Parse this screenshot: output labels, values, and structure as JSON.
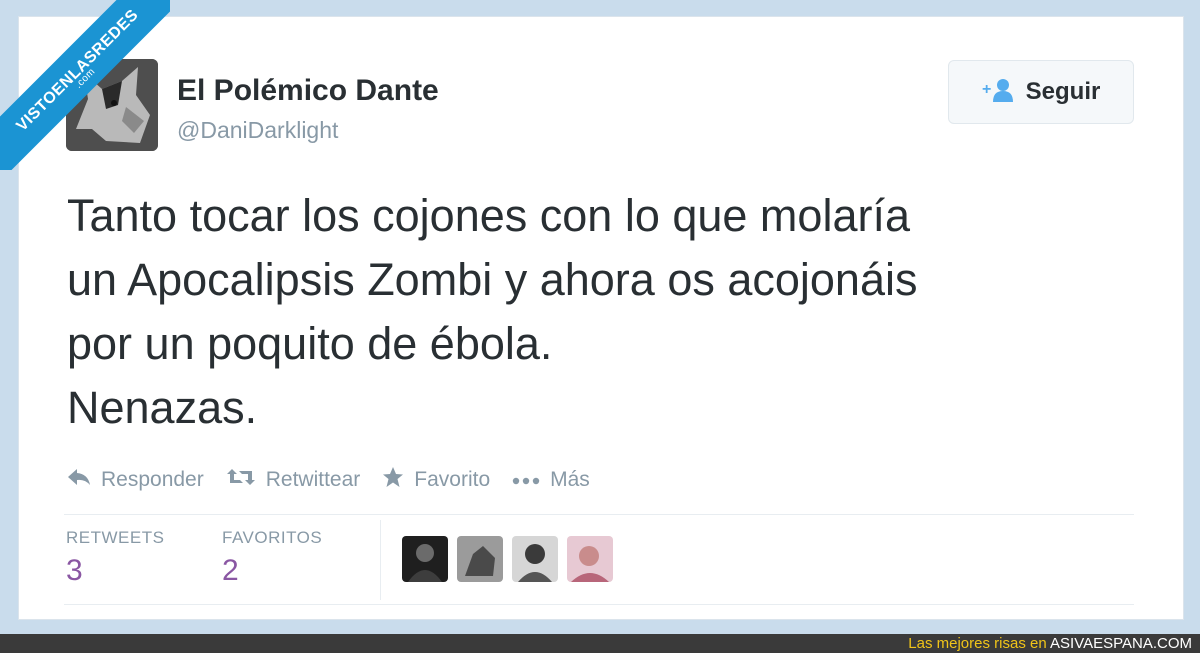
{
  "watermark": {
    "line1": "VISTOENLASREDES",
    "line2": ".com"
  },
  "tweet": {
    "display_name": "El Polémico Dante",
    "handle": "@DaniDarklight",
    "follow_label": "Seguir",
    "text": "Tanto tocar los cojones con lo que molaría\nun Apocalipsis Zombi y ahora os acojonáis\npor un poquito de ébola.\nNenazas."
  },
  "actions": {
    "reply": "Responder",
    "retweet": "Retwittear",
    "favorite": "Favorito",
    "more": "Más"
  },
  "stats": {
    "retweets_label": "RETWEETS",
    "retweets_value": "3",
    "favorites_label": "FAVORITOS",
    "favorites_value": "2"
  },
  "footer": {
    "prefix": "Las mejores risas en ",
    "brand": "ASIVAESPANA.COM"
  },
  "colors": {
    "accent": "#8a57a3",
    "muted": "#8899a6",
    "text": "#292f33",
    "ribbon": "#1b94d3",
    "footer_text": "#f0c419"
  }
}
